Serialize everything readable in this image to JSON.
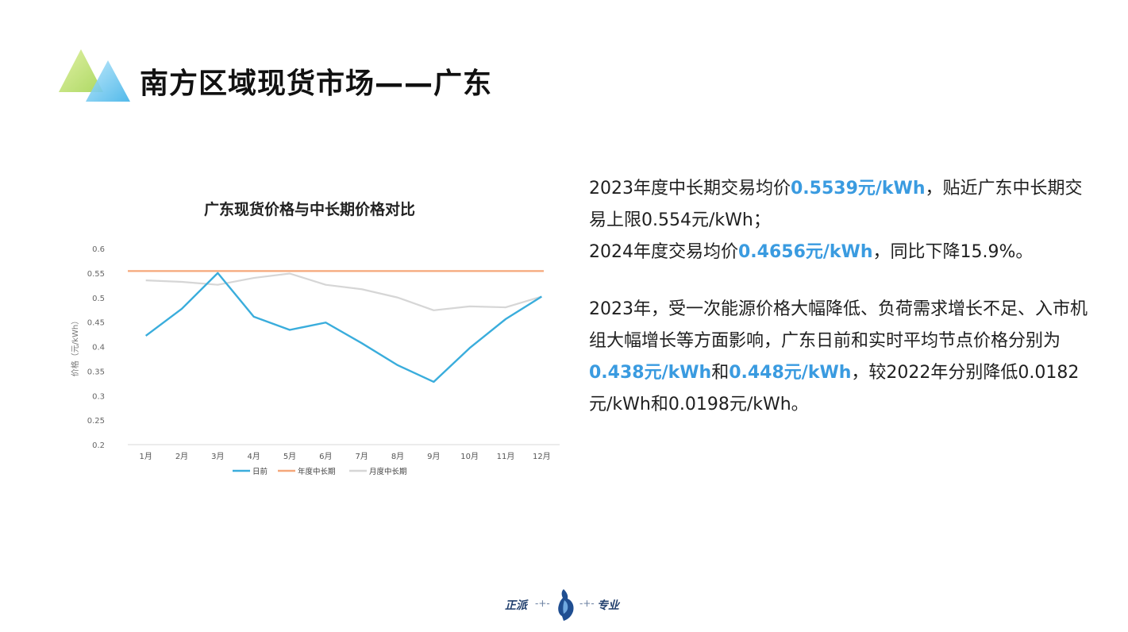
{
  "header": {
    "title": "南方区域现货市场——广东"
  },
  "chart_data": {
    "type": "line",
    "title": "广东现货价格与中长期价格对比",
    "ylabel": "价格（元/kWh）",
    "xlabel": "",
    "categories": [
      "1月",
      "2月",
      "3月",
      "4月",
      "5月",
      "6月",
      "7月",
      "8月",
      "9月",
      "10月",
      "11月",
      "12月"
    ],
    "ylim": [
      0.2,
      0.6
    ],
    "yticks": [
      "0.2",
      "0.25",
      "0.3",
      "0.35",
      "0.4",
      "0.45",
      "0.5",
      "0.55",
      "0.6"
    ],
    "grid": false,
    "legend_position": "bottom",
    "series": [
      {
        "name": "日前",
        "color": "#3aaddc",
        "values": [
          0.422,
          0.477,
          0.55,
          0.461,
          0.434,
          0.449,
          0.407,
          0.362,
          0.328,
          0.397,
          0.456,
          0.502
        ]
      },
      {
        "name": "年度中长期",
        "color": "#f5a77a",
        "values": [
          0.554,
          0.554,
          0.554,
          0.554,
          0.554,
          0.554,
          0.554,
          0.554,
          0.554,
          0.554,
          0.554,
          0.554
        ]
      },
      {
        "name": "月度中长期",
        "color": "#d6d6d6",
        "values": [
          0.535,
          0.532,
          0.526,
          0.54,
          0.549,
          0.526,
          0.517,
          0.5,
          0.474,
          0.482,
          0.48,
          0.502
        ]
      }
    ]
  },
  "description": {
    "p1": {
      "t1": "2023年度中长期交易均价",
      "h1": "0.5539元/kWh",
      "t2": "，贴近广东中长期交易上限0.554元/kWh；"
    },
    "p2": {
      "t1": "2024年度交易均价",
      "h1": "0.4656元/kWh",
      "t2": "，同比下降15.9%。"
    },
    "p3": {
      "t1": "2023年，受一次能源价格大幅降低、负荷需求增长不足、入市机组大幅增长等方面影响，广东日前和实时平均节点价格分别为",
      "h1": "0.438元/kWh",
      "t2": "和",
      "h2": "0.448元/kWh",
      "t3": "，较2022年分别降低0.0182元/kWh和0.0198元/kWh。"
    }
  },
  "footer": {
    "left": "正派",
    "right": "专业"
  },
  "colors": {
    "accent": "#3a9be0",
    "logo_green": "#c9e27a",
    "logo_blue": "#5ec1ee"
  }
}
